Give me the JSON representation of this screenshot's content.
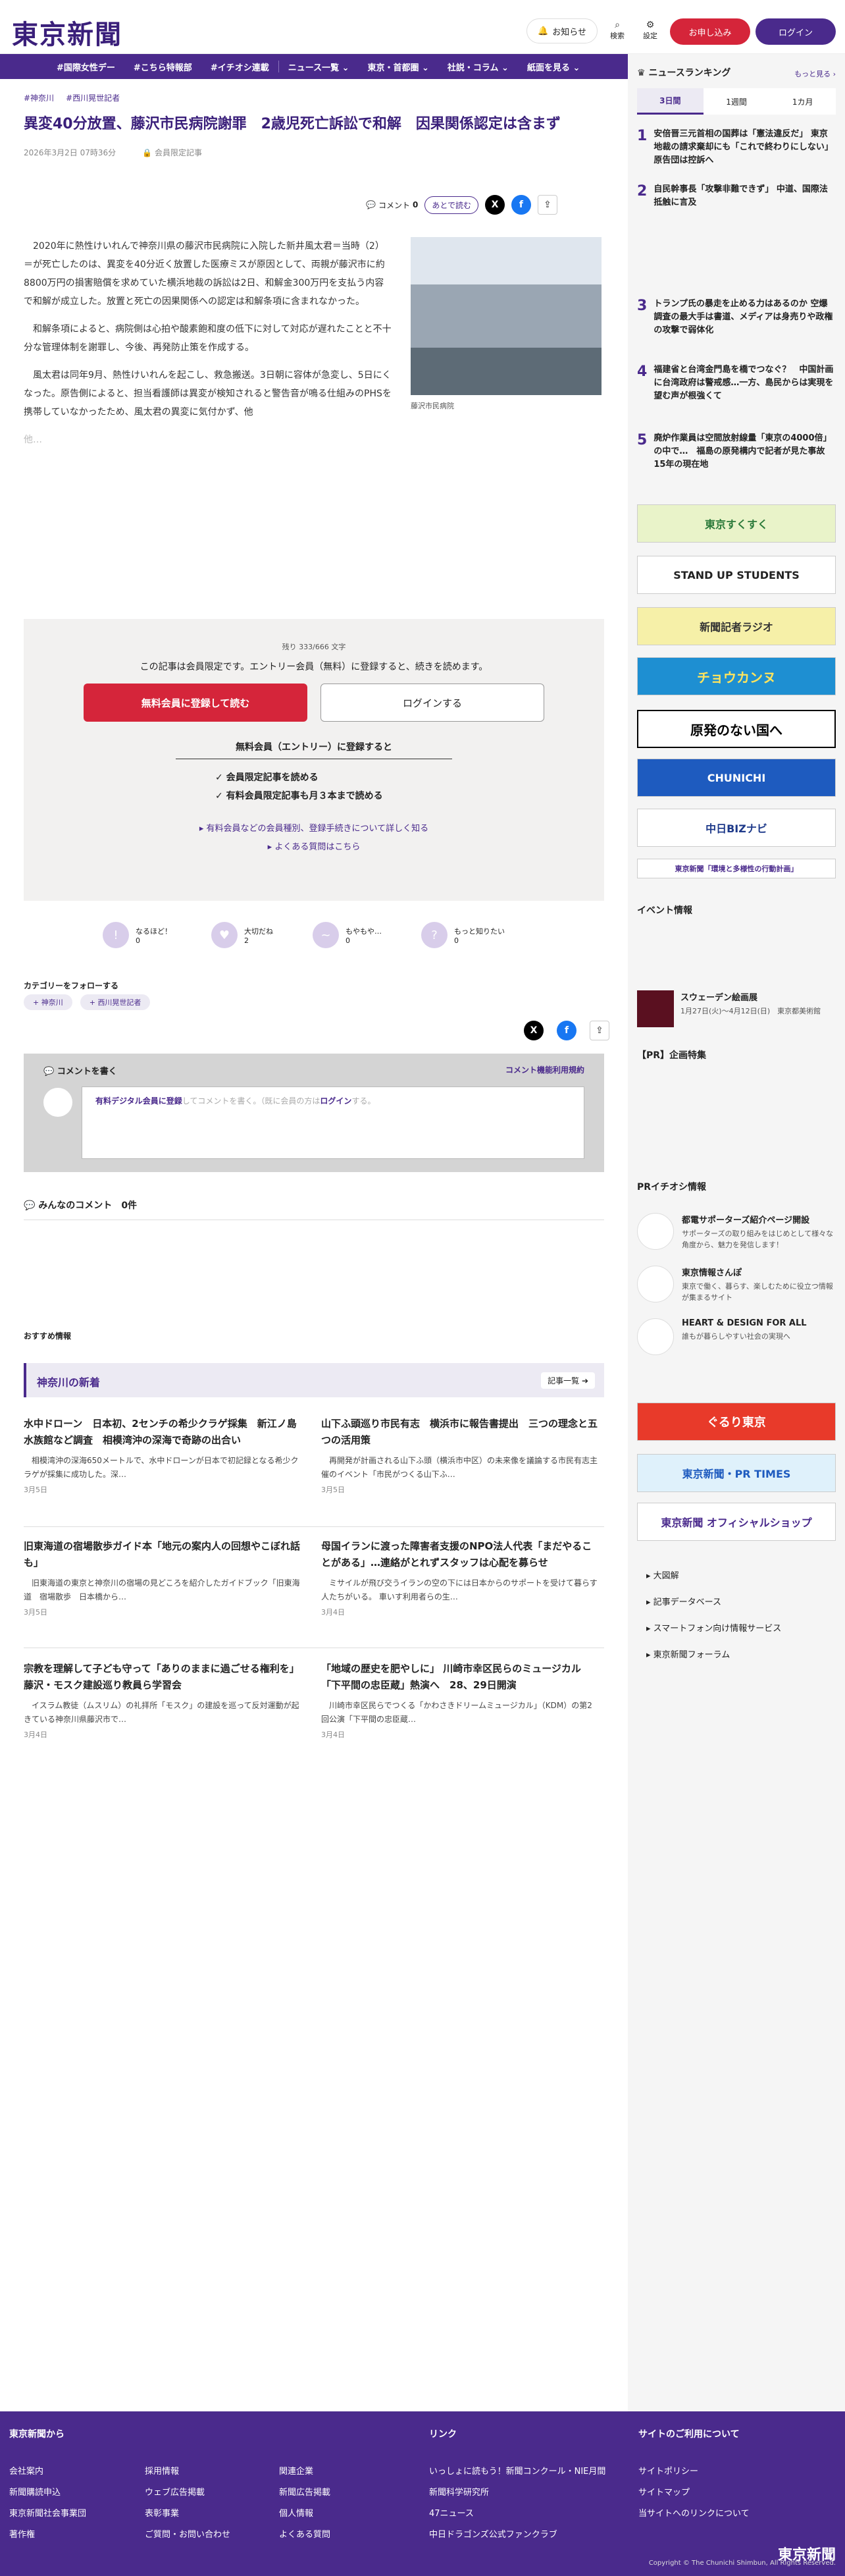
{
  "header": {
    "logo": "東京新聞",
    "notify": "お知らせ",
    "search": "検索",
    "settings": "設定",
    "subscribe": "お申し込み",
    "login": "ログイン"
  },
  "nav": [
    "#国際女性デー",
    "#こちら特報部",
    "#イチオシ連載",
    "ニュース一覧 ⌄",
    "東京・首都圏 ⌄",
    "社説・コラム ⌄",
    "紙面を見る ⌄"
  ],
  "article": {
    "tags": [
      "#神奈川",
      "#西川晃世記者"
    ],
    "title": "異変40分放置、藤沢市民病院謝罪　2歳児死亡訴訟で和解　因果関係認定は含まず",
    "date": "2026年3月2日 07時36分",
    "members_only": "会員限定記事",
    "comment_label": "コメント",
    "comment_count": "0",
    "read_later": "あとで読む",
    "paragraphs": [
      "　2020年に熱性けいれんで神奈川県の藤沢市民病院に入院した新井風太君＝当時（2）＝が死亡したのは、異変を40分近く放置した医療ミスが原因として、両親が藤沢市に約8800万円の損害賠償を求めていた横浜地裁の訴訟は2日、和解金300万円を支払う内容で和解が成立した。放置と死亡の因果関係への認定は和解条項に含まれなかった。",
      "　和解条項によると、病院側は心拍や酸素飽和度の低下に対して対応が遅れたことと不十分な管理体制を謝罪し、今後、再発防止策を作成する。",
      "　風太君は同年9月、熱性けいれんを起こし、救急搬送。3日朝に容体が急変し、5日にくなった。原告側によると、担当看護師は異変が検知されると警告音が鳴る仕組みのPHSを携帯していなかったため、風太君の異変に気付かず、他"
    ],
    "fade_text": "他…",
    "photo_caption": "藤沢市民病院"
  },
  "paywall": {
    "count": "残り 333/666 文字",
    "message": "この記事は会員限定です。エントリー会員（無料）に登録すると、続きを読めます。",
    "register": "無料会員に登録して読む",
    "login": "ログインする",
    "heading": "無料会員（エントリー）に登録すると",
    "benefits": [
      "会員限定記事を読める",
      "有料会員限定記事も月３本まで読める"
    ],
    "link1": "有料会員などの会員種別、登録手続きについて詳しく知る",
    "link2": "よくある質問はこちら"
  },
  "reactions": [
    {
      "label": "なるほど！",
      "count": "0"
    },
    {
      "label": "大切だね",
      "count": "2"
    },
    {
      "label": "もやもや…",
      "count": "0"
    },
    {
      "label": "もっと知りたい",
      "count": "0"
    }
  ],
  "follow": {
    "heading": "カテゴリーをフォローする",
    "tags": [
      "神奈川",
      "西川晃世記者"
    ]
  },
  "comment_box": {
    "heading": "コメントを書く",
    "rules": "コメント機能利用規約",
    "placeholder_a": "有料デジタル会員に登録",
    "placeholder_b": "してコメントを書く。（既に会員の方は",
    "placeholder_c": "ログイン",
    "placeholder_d": "する。"
  },
  "comments": {
    "label": "みんなのコメント",
    "count": "0件"
  },
  "recommended": "おすすめ情報",
  "kanagawa": {
    "title": "神奈川の新着",
    "more": "記事一覧"
  },
  "cards": [
    {
      "title": "水中ドローン　日本初、2センチの希少クラゲ採集　新江ノ島水族館など調査　相模湾沖の深海で奇跡の出合い",
      "desc": "　相模湾沖の深海650メートルで、水中ドローンが日本で初記録となる希少クラゲが採集に成功した。深…",
      "date": "3月5日"
    },
    {
      "title": "山下ふ頭巡り市民有志　横浜市に報告書提出　三つの理念と五つの活用策",
      "desc": "　再開発が計画される山下ふ頭（横浜市中区）の未来像を議論する市民有志主催のイベント「市民がつくる山下ふ…",
      "date": "3月5日"
    },
    {
      "title": "旧東海道の宿場散歩ガイド本「地元の案内人の回想やこぼれ話も」",
      "desc": "　旧東海道の東京と神奈川の宿場の見どころを紹介したガイドブック「旧東海道　宿場散歩　日本橋から…",
      "date": "3月5日"
    },
    {
      "title": "母国イランに渡った障害者支援のNPO法人代表「まだやることがある」…連絡がとれずスタッフは心配を募らせ",
      "desc": "　ミサイルが飛び交うイランの空の下には日本からのサポートを受けて暮らす人たちがいる。 車いす利用者らの生…",
      "date": "3月4日"
    },
    {
      "title": "宗教を理解して子ども守って「ありのままに過ごせる権利を」 藤沢・モスク建設巡り教員ら学習会",
      "desc": "　イスラム教徒（ムスリム）の礼拝所「モスク」の建設を巡って反対運動が起きている神奈川県藤沢市で…",
      "date": "3月4日"
    },
    {
      "title": "「地域の歴史を肥やしに」 川崎市幸区民らのミュージカル「下平間の忠臣蔵」熱演へ　28、29日開演",
      "desc": "　川崎市幸区民らでつくる「かわさきドリームミュージカル」（KDM）の第2回公演「下平間の忠臣蔵…",
      "date": "3月4日"
    }
  ],
  "sidebar": {
    "ranking_title": "ニュースランキング",
    "ranking_more": "もっと見る",
    "tabs": [
      "3日間",
      "1週間",
      "1カ月"
    ],
    "ranks": [
      {
        "n": "1",
        "t": "安倍晋三元首相の国葬は「憲法違反だ」 東京地裁の請求棄却にも「これで終わりにしない」 原告団は控訴へ"
      },
      {
        "n": "2",
        "t": "自民幹事長「攻撃非難できず」 中道、国際法抵触に言及"
      },
      {
        "n": "3",
        "t": "トランプ氏の暴走を止める力はあるのか 空爆調査の最大手は書道、メディアは身売りや政権の攻撃で弱体化"
      },
      {
        "n": "4",
        "t": "福建省と台湾金門島を橋でつなぐ？　中国計画に台湾政府は警戒感…一方、島民からは実現を望む声が根強くて"
      },
      {
        "n": "5",
        "t": "廃炉作業員は空間放射線量「東京の4000倍」の中で…　福島の原発構内で記者が見た事故15年の現在地"
      }
    ],
    "banners": [
      "東京すくすく",
      "STAND UP STUDENTS",
      "新聞記者ラジオ",
      "チョウカンヌ",
      "原発のない国へ",
      "CHUNICHI",
      "中日BIZナビ",
      "東京新聞「環境と多様性の行動計画」"
    ],
    "events_title": "イベント情報",
    "event": {
      "title": "スウェーデン絵画展",
      "date": "1月27日(火)～4月12日(日)　東京都美術館"
    },
    "pr_title": "【PR】企画特集",
    "pr_pick": "PRイチオシ情報",
    "pr": [
      {
        "t": "都電サポーターズ紹介ページ開設",
        "d": "サポーターズの取り組みをはじめとして様々な角度から、魅力を発信します！"
      },
      {
        "t": "東京情報さんぽ",
        "d": "東京で働く、暮らす、楽しむために役立つ情報が集まるサイト"
      },
      {
        "t": "HEART & DESIGN FOR ALL",
        "d": "誰もが暮らしやすい社会の実現へ"
      }
    ],
    "banners2": [
      "ぐるり東京",
      "東京新聞・PR TIMES",
      "東京新聞 オフィシャルショップ"
    ],
    "links": [
      "大図解",
      "記事データベース",
      "スマートフォン向け情報サービス",
      "東京新聞フォーラム"
    ]
  },
  "footer": {
    "col1_title": "東京新聞から",
    "col1": [
      "会社案内",
      "新聞購読申込",
      "東京新聞社会事業団",
      "著作権",
      "採用情報",
      "ウェブ広告掲載",
      "表彰事業",
      "ご質問・お問い合わせ",
      "関連企業",
      "新聞広告掲載",
      "個人情報",
      "よくある質問"
    ],
    "col2_title": "リンク",
    "col2": [
      "いっしょに読もう！新聞コンクール・NIE月間",
      "新聞科学研究所",
      "47ニュース",
      "中日ドラゴンズ公式ファンクラブ"
    ],
    "col3_title": "サイトのご利用について",
    "col3": [
      "サイトポリシー",
      "サイトマップ",
      "当サイトへのリンクについて"
    ],
    "logo": "東京新聞",
    "copyright": "Copyright © The Chunichi Shimbun, All Rights Reserved."
  }
}
